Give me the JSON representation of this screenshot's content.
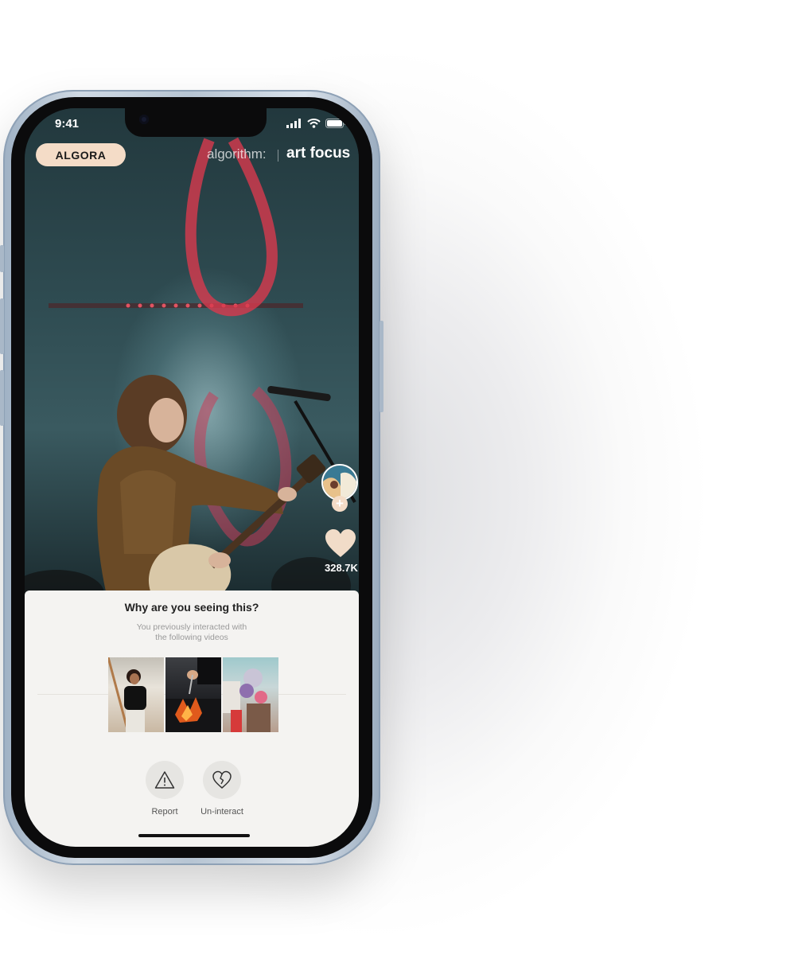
{
  "status_bar": {
    "time": "9:41"
  },
  "header": {
    "logo": "ALGORA",
    "algorithm_label": "algorithm:",
    "algorithm_value": "art focus"
  },
  "feed": {
    "likes_count": "328.7K",
    "follow_symbol": "+"
  },
  "why_sheet": {
    "title": "Why are you seeing this?",
    "subtitle_line1": "You previously interacted with",
    "subtitle_line2": "the following videos",
    "actions": [
      {
        "label": "Report",
        "icon": "warning-icon"
      },
      {
        "label": "Un-interact",
        "icon": "broken-heart-icon"
      }
    ]
  },
  "colors": {
    "accent_peach": "#f4dcc7",
    "sheet_background": "#f4f3f1"
  }
}
